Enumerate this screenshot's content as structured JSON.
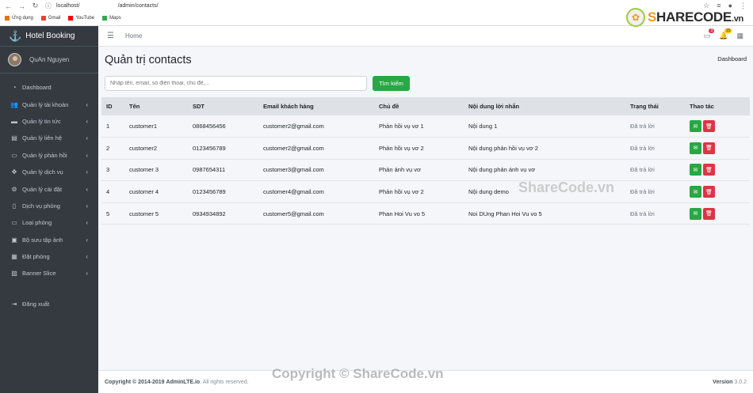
{
  "browser": {
    "url_prefix": "localhost/",
    "url_suffix": "/admin/contacts/",
    "bookmarks": [
      {
        "label": "Ứng dụng",
        "color": "#e8710a"
      },
      {
        "label": "Gmail",
        "color": "#ea4335"
      },
      {
        "label": "YouTube",
        "color": "#ff0000"
      },
      {
        "label": "Maps",
        "color": "#34a853"
      }
    ]
  },
  "watermark_logo": {
    "text": "HARECODE",
    "first": "S",
    "suffix": ".vn"
  },
  "sidebar": {
    "brand": "Hotel Booking",
    "user_name": "QuAn Nguyen",
    "items": [
      {
        "label": "Dashboard",
        "icon": "tachometer-icon",
        "glyph": "◔",
        "caret": false
      },
      {
        "label": "Quản lý tài khoản",
        "icon": "users-icon",
        "glyph": "👥",
        "caret": true
      },
      {
        "label": "Quản lý tin tức",
        "icon": "newspaper-icon",
        "glyph": "▬",
        "caret": true
      },
      {
        "label": "Quản lý liên hệ",
        "icon": "address-book-icon",
        "glyph": "▤",
        "caret": true
      },
      {
        "label": "Quản lý phản hồi",
        "icon": "comment-icon",
        "glyph": "▭",
        "caret": true
      },
      {
        "label": "Quản lý dịch vụ",
        "icon": "handshake-icon",
        "glyph": "✥",
        "caret": true
      },
      {
        "label": "Quản lý cài đặt",
        "icon": "cogs-icon",
        "glyph": "⚙",
        "caret": true
      },
      {
        "label": "Dịch vụ phòng",
        "icon": "file-icon",
        "glyph": "▯",
        "caret": true
      },
      {
        "label": "Loại phòng",
        "icon": "bed-icon",
        "glyph": "▭",
        "caret": true
      },
      {
        "label": "Bộ sưu tập ảnh",
        "icon": "images-icon",
        "glyph": "▣",
        "caret": true
      },
      {
        "label": "Đặt phòng",
        "icon": "calendar-icon",
        "glyph": "▦",
        "caret": true
      },
      {
        "label": "Banner Slice",
        "icon": "image-icon",
        "glyph": "▨",
        "caret": true
      }
    ],
    "logout": "Đăng xuất"
  },
  "topbar": {
    "home": "Home",
    "badge1": "3",
    "badge2": "15"
  },
  "page": {
    "title": "Quản trị contacts",
    "breadcrumb": "Dashboard",
    "search_placeholder": "Nhập tên, email, số điện thoại, chủ đề,...",
    "search_button": "Tìm kiếm"
  },
  "table": {
    "headers": [
      "ID",
      "Tên",
      "SDT",
      "Email khách hàng",
      "Chủ đề",
      "Nội dung lời nhắn",
      "Trạng thái",
      "Thao tác"
    ],
    "rows": [
      [
        "1",
        "customer1",
        "0868456456",
        "customer2@gmail.com",
        "Phản hồi vụ vơ 1",
        "Nội dung 1",
        "Đã trả lời"
      ],
      [
        "2",
        "customer2",
        "0123456789",
        "customer2@gmail.com",
        "Phản hồi vụ vơ 2",
        "Nội dung phản hồi vụ vơ 2",
        "Đã trả lời"
      ],
      [
        "3",
        "customer 3",
        "0987654311",
        "customer3@gmail.com",
        "Phản ánh vụ vơ",
        "Nội dung phản ánh vụ vơ",
        "Đã trả lời"
      ],
      [
        "4",
        "customer 4",
        "0123456789",
        "customer4@gmail.com",
        "Phản hồi vụ vơ 2",
        "Nội dung demo",
        "Đã trả lời"
      ],
      [
        "5",
        "customer 5",
        "0934934892",
        "customer5@gmail.com",
        "Phan Hoi Vu vo 5",
        "Noi DUng Phan Hoi Vu vo 5",
        "Đã trả lời"
      ]
    ]
  },
  "overlay_watermark": "ShareCode.vn",
  "footer": {
    "copyright": "Copyright © 2014-2019",
    "brand": "AdminLTE.io",
    "rights": ". All rights reserved.",
    "version_label": "Version",
    "version": "3.0.2"
  },
  "copy_watermark": "Copyright © ShareCode.vn"
}
